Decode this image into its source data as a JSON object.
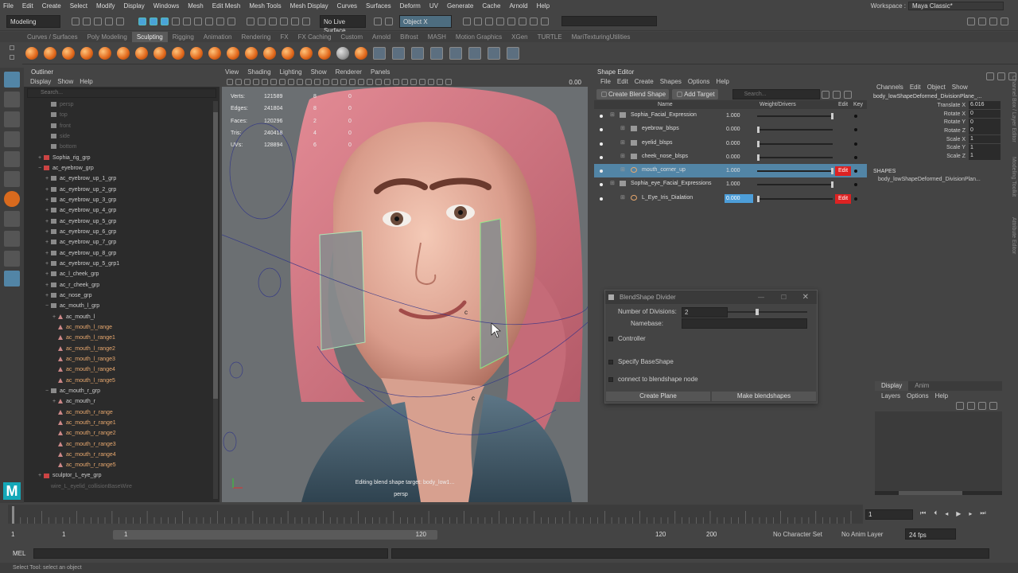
{
  "menubar": {
    "items": [
      "File",
      "Edit",
      "Create",
      "Select",
      "Modify",
      "Display",
      "Windows",
      "Mesh",
      "Edit Mesh",
      "Mesh Tools",
      "Mesh Display",
      "Curves",
      "Surfaces",
      "Deform",
      "UV",
      "Generate",
      "Cache",
      "Arnold",
      "Help"
    ],
    "workspace_label": "Workspace :",
    "workspace_value": "Maya Classic*"
  },
  "statusline": {
    "mode": "Modeling",
    "live_surface": "No Live Surface",
    "object_mode": "Object X"
  },
  "shelf_tabs": [
    "Curves / Surfaces",
    "Poly Modeling",
    "Sculpting",
    "Rigging",
    "Animation",
    "Rendering",
    "FX",
    "FX Caching",
    "Custom",
    "Arnold",
    "Bifrost",
    "MASH",
    "Motion Graphics",
    "XGen",
    "TURTLE",
    "MariTexturingUtilities"
  ],
  "shelf_active": "Sculpting",
  "outliner": {
    "title": "Outliner",
    "menu": [
      "Display",
      "Show",
      "Help"
    ],
    "search_placeholder": "Search...",
    "items": [
      {
        "label": "persp",
        "indent": 1,
        "style": "dim",
        "icon": "cam"
      },
      {
        "label": "top",
        "indent": 1,
        "style": "dim",
        "icon": "cam"
      },
      {
        "label": "front",
        "indent": 1,
        "style": "dim",
        "icon": "cam"
      },
      {
        "label": "side",
        "indent": 1,
        "style": "dim",
        "icon": "cam"
      },
      {
        "label": "bottom",
        "indent": 1,
        "style": "dim",
        "icon": "cam"
      },
      {
        "label": "Sophia_rig_grp",
        "indent": 0,
        "style": "",
        "icon": "grp",
        "exp": "+"
      },
      {
        "label": "ac_eyebrow_grp",
        "indent": 0,
        "style": "",
        "icon": "grp",
        "exp": "-"
      },
      {
        "label": "ac_eyebrow_up_1_grp",
        "indent": 1,
        "style": "",
        "icon": "grp",
        "exp": "+"
      },
      {
        "label": "ac_eyebrow_up_2_grp",
        "indent": 1,
        "style": "",
        "icon": "grp",
        "exp": "+"
      },
      {
        "label": "ac_eyebrow_up_3_grp",
        "indent": 1,
        "style": "",
        "icon": "grp",
        "exp": "+"
      },
      {
        "label": "ac_eyebrow_up_4_grp",
        "indent": 1,
        "style": "",
        "icon": "grp",
        "exp": "+"
      },
      {
        "label": "ac_eyebrow_up_5_grp",
        "indent": 1,
        "style": "",
        "icon": "grp",
        "exp": "+"
      },
      {
        "label": "ac_eyebrow_up_6_grp",
        "indent": 1,
        "style": "",
        "icon": "grp",
        "exp": "+"
      },
      {
        "label": "ac_eyebrow_up_7_grp",
        "indent": 1,
        "style": "",
        "icon": "grp",
        "exp": "+"
      },
      {
        "label": "ac_eyebrow_up_8_grp",
        "indent": 1,
        "style": "",
        "icon": "grp",
        "exp": "+"
      },
      {
        "label": "ac_eyebrow_up_5_grp1",
        "indent": 1,
        "style": "",
        "icon": "grp",
        "exp": "+"
      },
      {
        "label": "ac_l_cheek_grp",
        "indent": 1,
        "style": "",
        "icon": "grp",
        "exp": "+"
      },
      {
        "label": "ac_r_cheek_grp",
        "indent": 1,
        "style": "",
        "icon": "grp",
        "exp": "+"
      },
      {
        "label": "ac_nose_grp",
        "indent": 1,
        "style": "",
        "icon": "grp",
        "exp": "+"
      },
      {
        "label": "ac_mouth_l_grp",
        "indent": 1,
        "style": "",
        "icon": "grp",
        "exp": "-"
      },
      {
        "label": "ac_mouth_l",
        "indent": 2,
        "style": "",
        "icon": "tri",
        "exp": "+"
      },
      {
        "label": "ac_mouth_l_range",
        "indent": 2,
        "style": "orange",
        "icon": "tri",
        "exp": ""
      },
      {
        "label": "ac_mouth_l_range1",
        "indent": 2,
        "style": "orange",
        "icon": "tri",
        "exp": ""
      },
      {
        "label": "ac_mouth_l_range2",
        "indent": 2,
        "style": "orange",
        "icon": "tri",
        "exp": ""
      },
      {
        "label": "ac_mouth_l_range3",
        "indent": 2,
        "style": "orange",
        "icon": "tri",
        "exp": ""
      },
      {
        "label": "ac_mouth_l_range4",
        "indent": 2,
        "style": "orange",
        "icon": "tri",
        "exp": ""
      },
      {
        "label": "ac_mouth_l_range5",
        "indent": 2,
        "style": "orange",
        "icon": "tri",
        "exp": ""
      },
      {
        "label": "ac_mouth_r_grp",
        "indent": 1,
        "style": "",
        "icon": "grp",
        "exp": "-"
      },
      {
        "label": "ac_mouth_r",
        "indent": 2,
        "style": "",
        "icon": "tri",
        "exp": "+"
      },
      {
        "label": "ac_mouth_r_range",
        "indent": 2,
        "style": "orange",
        "icon": "tri",
        "exp": ""
      },
      {
        "label": "ac_mouth_r_range1",
        "indent": 2,
        "style": "orange",
        "icon": "tri",
        "exp": ""
      },
      {
        "label": "ac_mouth_r_range2",
        "indent": 2,
        "style": "orange",
        "icon": "tri",
        "exp": ""
      },
      {
        "label": "ac_mouth_r_range3",
        "indent": 2,
        "style": "orange",
        "icon": "tri",
        "exp": ""
      },
      {
        "label": "ac_mouth_r_range4",
        "indent": 2,
        "style": "orange",
        "icon": "tri",
        "exp": ""
      },
      {
        "label": "ac_mouth_r_range5",
        "indent": 2,
        "style": "orange",
        "icon": "tri",
        "exp": ""
      },
      {
        "label": "sculptor_L_eye_grp",
        "indent": 0,
        "style": "",
        "icon": "grp",
        "exp": "+"
      },
      {
        "label": "wire_L_eyelid_collisionBaseWire",
        "indent": 1,
        "style": "dim",
        "icon": "none",
        "exp": ""
      }
    ]
  },
  "viewport": {
    "menu": [
      "View",
      "Shading",
      "Lighting",
      "Show",
      "Renderer",
      "Panels"
    ],
    "field_value": "0.00",
    "hud": [
      {
        "label": "Verts:",
        "v1": "121589",
        "v2": "8",
        "v3": "0"
      },
      {
        "label": "Edges:",
        "v1": "241804",
        "v2": "8",
        "v3": "0"
      },
      {
        "label": "Faces:",
        "v1": "120296",
        "v2": "2",
        "v3": "0"
      },
      {
        "label": "Tris:",
        "v1": "240418",
        "v2": "4",
        "v3": "0"
      },
      {
        "label": "UVs:",
        "v1": "128894",
        "v2": "6",
        "v3": "0"
      }
    ],
    "status_message": "Editing blend shape target: body_low1...",
    "camera_label": "persp"
  },
  "shape_editor": {
    "title": "Shape Editor",
    "menu": [
      "File",
      "Edit",
      "Create",
      "Shapes",
      "Options",
      "Help"
    ],
    "create_blend_shape": "Create Blend Shape",
    "add_target": "Add Target",
    "search_placeholder": "Search...",
    "col_name": "Name",
    "col_weight": "Weight/Drivers",
    "col_edit": "Edit",
    "col_key": "Key",
    "rows": [
      {
        "name": "Sophia_Facial_Expression",
        "value": "1.000",
        "knob": 1.0,
        "indent": 0,
        "edit": false,
        "hl": false,
        "bluev": false,
        "icon": "folder"
      },
      {
        "name": "eyebrow_blsps",
        "value": "0.000",
        "knob": 0.0,
        "indent": 1,
        "edit": false,
        "hl": false,
        "bluev": false,
        "icon": "folder"
      },
      {
        "name": "eyelid_blsps",
        "value": "0.000",
        "knob": 0.0,
        "indent": 1,
        "edit": false,
        "hl": false,
        "bluev": false,
        "icon": "folder"
      },
      {
        "name": "cheek_nose_blsps",
        "value": "0.000",
        "knob": 0.0,
        "indent": 1,
        "edit": false,
        "hl": false,
        "bluev": false,
        "icon": "folder"
      },
      {
        "name": "mouth_corner_up",
        "value": "1.000",
        "knob": 1.0,
        "indent": 1,
        "edit": true,
        "hl": true,
        "bluev": false,
        "icon": "target"
      },
      {
        "name": "Sophia_eye_Facial_Expressions",
        "value": "1.000",
        "knob": 1.0,
        "indent": 0,
        "edit": false,
        "hl": false,
        "bluev": false,
        "icon": "folder"
      },
      {
        "name": "L_Eye_Iris_Dialation",
        "value": "0.000",
        "knob": 0.0,
        "indent": 1,
        "edit": true,
        "hl": false,
        "bluev": true,
        "icon": "target"
      }
    ],
    "edit_label": "Edit"
  },
  "dialog": {
    "title": "BlendShape Divider",
    "divisions_label": "Number of Divisions:",
    "divisions_value": "2",
    "divisions_level": 0.35,
    "namebase_label": "Namebase:",
    "controller_label": "Controller",
    "specify_label": "Specify BaseShape",
    "connect_label": "connect to blendshape node",
    "create_plane": "Create Plane",
    "make_blendshapes": "Make blendshapes"
  },
  "channel_box": {
    "menu": [
      "Channels",
      "Edit",
      "Object",
      "Show"
    ],
    "object_name": "body_lowShapeDeformed_DivisionPlane_...",
    "attrs": [
      {
        "label": "Translate X",
        "value": "6.016"
      },
      {
        "label": "Rotate X",
        "value": "0"
      },
      {
        "label": "Rotate Y",
        "value": "0"
      },
      {
        "label": "Rotate Z",
        "value": "0"
      },
      {
        "label": "Scale X",
        "value": "1"
      },
      {
        "label": "Scale Y",
        "value": "1"
      },
      {
        "label": "Scale Z",
        "value": "1"
      }
    ],
    "shapes_header": "SHAPES",
    "shape_name": "body_lowShapeDeformed_DivisionPlan...",
    "layer_tabs": [
      "Display",
      "Anim"
    ],
    "layer_menu": [
      "Layers",
      "Options",
      "Help"
    ],
    "side_tabs": [
      "Channel Box / Layer Editor",
      "Modeling Toolkit",
      "Attribute Editor"
    ]
  },
  "timeline": {
    "current_frame": "1",
    "range_start": "1",
    "range_start2": "1",
    "range_end_inner": "120",
    "range_end": "120",
    "range_end2": "200",
    "no_character": "No Character Set",
    "no_anim_layer": "No Anim Layer",
    "fps": "24 fps"
  },
  "cmdline": {
    "label": "MEL"
  },
  "helpline": {
    "text": "Select Tool: select an object"
  }
}
